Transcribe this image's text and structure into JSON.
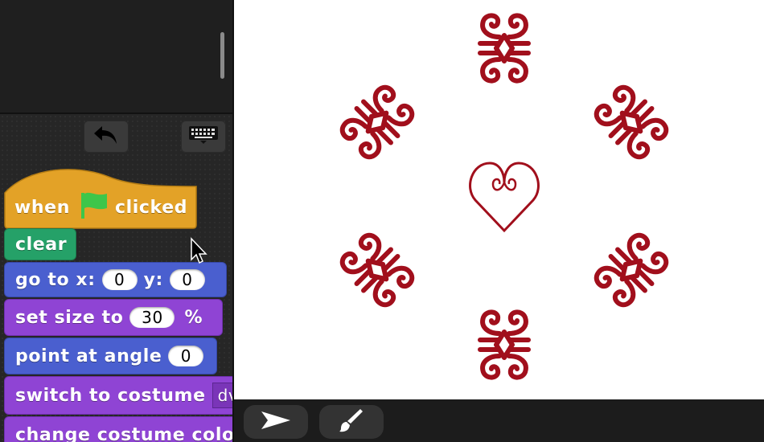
{
  "palette": {
    "undo_icon": "undo-arrow-icon",
    "keyboard_icon": "keyboard-icon"
  },
  "script": {
    "hat": {
      "when": "when",
      "clicked": "clicked",
      "flag_icon": "green-flag-icon"
    },
    "clear": "clear",
    "goto": {
      "label_x": "go to x:",
      "x_value": "0",
      "label_y": "y:",
      "y_value": "0"
    },
    "setsize": {
      "label": "set size to",
      "value": "30",
      "unit": "%"
    },
    "point": {
      "label": "point at angle",
      "value": "0"
    },
    "switch": {
      "label": "switch to costume",
      "value": "dv"
    },
    "change": {
      "label": "change costume colo"
    }
  },
  "stage": {
    "figure_color": "#a10f1c",
    "heart_icon": "heart-outline-icon",
    "motif_icon": "adinkra-swirl-icon"
  },
  "bottom_bar": {
    "arrow_icon": "pointer-arrow-icon",
    "paint_icon": "paintbrush-icon"
  },
  "colors": {
    "hat": "#e3a227",
    "control_green": "#25a168",
    "motion_blue": "#4a5fcf",
    "looks_purple": "#8f44d4",
    "flag_green": "#3ec64a"
  }
}
